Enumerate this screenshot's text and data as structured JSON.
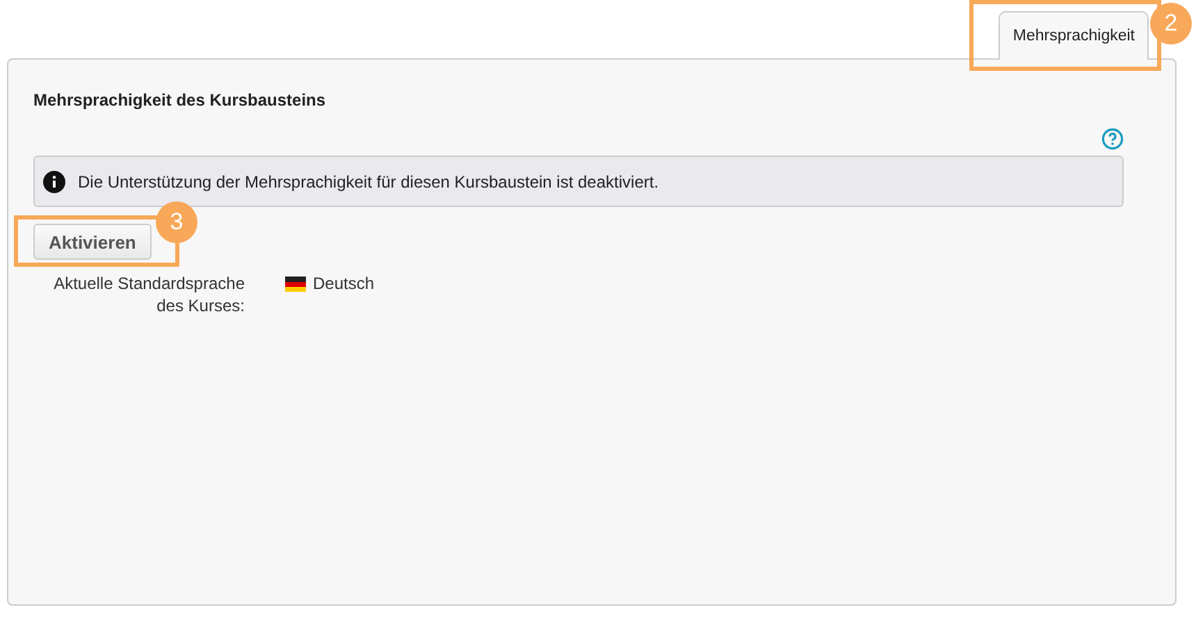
{
  "tabs": [
    {
      "label": "Mehrsprachigkeit",
      "selected": true
    }
  ],
  "section": {
    "title": "Mehrsprachigkeit des Kursbausteins"
  },
  "info": {
    "message": "Die Unterstützung der Mehrsprachigkeit für diesen Kursbaustein ist deaktiviert."
  },
  "button": {
    "label": "Aktivieren"
  },
  "default_language": {
    "label": "Aktuelle Standardsprache des Kurses:",
    "value": "Deutsch"
  },
  "callouts": [
    {
      "number": "2"
    },
    {
      "number": "3"
    }
  ]
}
